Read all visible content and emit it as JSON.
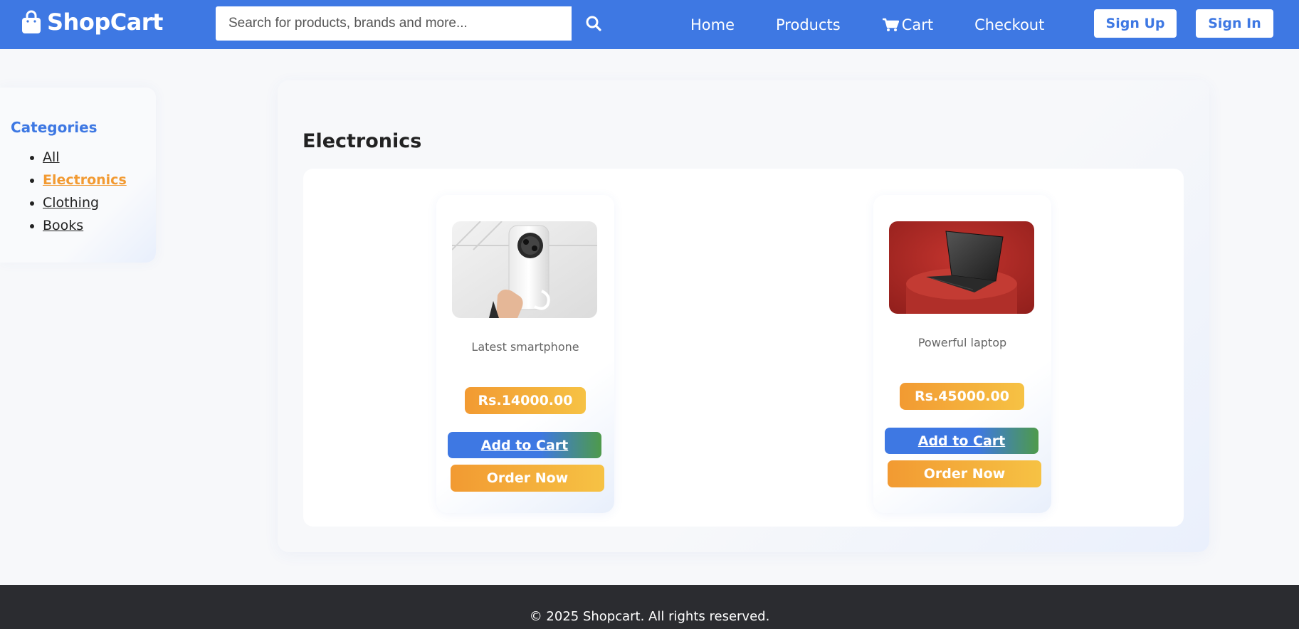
{
  "header": {
    "brand": "ShopCart",
    "search_placeholder": "Search for products, brands and more...",
    "nav": [
      "Home",
      "Products",
      "Cart",
      "Checkout"
    ],
    "signup_label": "Sign Up",
    "signin_label": "Sign In"
  },
  "sidebar": {
    "title": "Categories",
    "items": [
      "All",
      "Electronics",
      "Clothing",
      "Books"
    ],
    "active": "Electronics"
  },
  "main": {
    "heading": "Electronics",
    "products": [
      {
        "description": "Latest smartphone",
        "price": "Rs.14000.00",
        "add_label": "Add to Cart",
        "order_label": "Order Now"
      },
      {
        "description": "Powerful laptop",
        "price": "Rs.45000.00",
        "add_label": "Add to Cart",
        "order_label": "Order Now"
      }
    ]
  },
  "footer": {
    "text": "© 2025 Shopcart. All rights reserved."
  },
  "colors": {
    "primary": "#3e78e3",
    "accent": "#f29a32",
    "footer": "#2b2c30"
  }
}
